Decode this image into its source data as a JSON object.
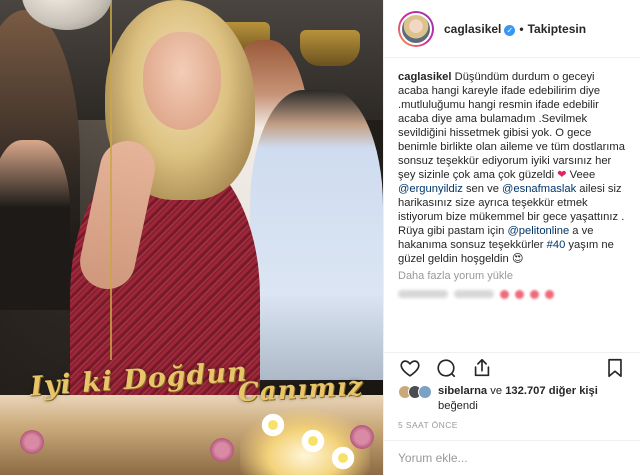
{
  "post": {
    "username": "caglasikel",
    "follow_state": "Takiptesin",
    "caption_parts": [
      {
        "t": "text",
        "v": "Düşündüm durdum o geceyi acaba hangi kareyle ifade edebilirim diye .mutluluğumu hangi resmin ifade edebilir acaba diye ama bulamadım .Sevilmek sevildiğini hissetmek gibisi yok. O gece benimle birlikte olan aileme ve tüm dostlarıma sonsuz teşekkür ediyorum iyiki varsınız her şey sizinle çok ama çok güzeldi "
      },
      {
        "t": "heart",
        "v": "❤"
      },
      {
        "t": "text",
        "v": " Veee "
      },
      {
        "t": "mention",
        "v": "@ergunyildiz"
      },
      {
        "t": "text",
        "v": " sen ve "
      },
      {
        "t": "mention",
        "v": "@esnafmaslak"
      },
      {
        "t": "text",
        "v": " ailesi siz harikasınız size ayrıca teşekkür etmek istiyorum bize mükemmel bir gece yaşattınız . Rüya gibi pastam için "
      },
      {
        "t": "mention",
        "v": "@pelitonline"
      },
      {
        "t": "text",
        "v": " a ve hakanıma sonsuz teşekkürler "
      },
      {
        "t": "hashtag",
        "v": "#40"
      },
      {
        "t": "text",
        "v": " yaşım ne güzel geldin hoşgeldin "
      },
      {
        "t": "emoji",
        "v": "😍"
      }
    ],
    "more_comments": "Daha fazla yorum yükle",
    "likes_user": "sibelarna",
    "likes_connector": "ve",
    "likes_count": "132.707 diğer kişi",
    "likes_suffix": "beğendi",
    "time_ago": "5 SAAT ÖNCE",
    "comment_placeholder": "Yorum ekle..."
  },
  "cake": {
    "topper_left": "Iyi ki Doğdun",
    "topper_right": "Canımız"
  },
  "icons": {
    "like": "heart-outline-icon",
    "comment": "speech-bubble-icon",
    "share": "share-upload-icon",
    "save": "bookmark-icon",
    "verified": "verified-badge-icon"
  },
  "colors": {
    "link": "#003569",
    "verified": "#3897f0",
    "muted": "#999999"
  }
}
